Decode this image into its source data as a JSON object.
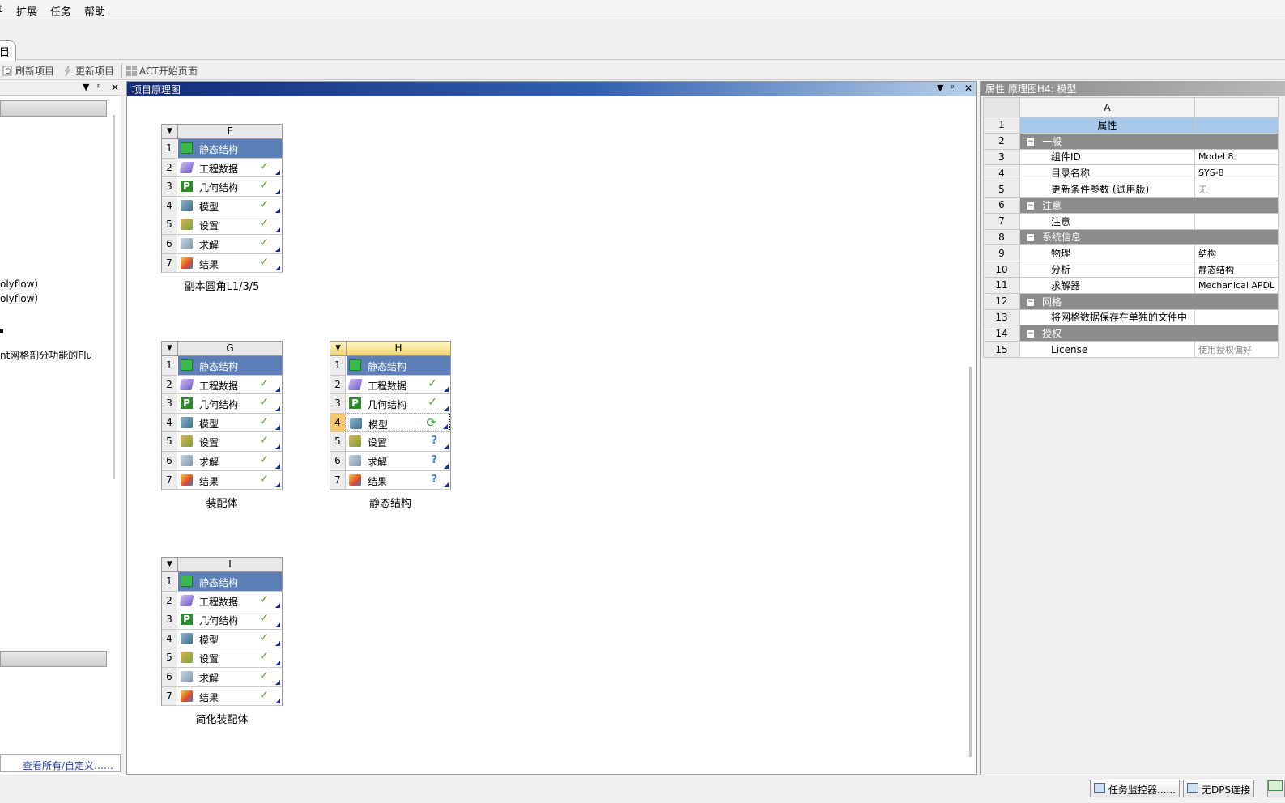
{
  "menu": {
    "items": [
      "扩展",
      "任务",
      "帮助"
    ],
    "cut_item": "t"
  },
  "ribbon": {
    "tab_label": "目"
  },
  "toolbar": {
    "refresh_label": "刷新项目",
    "update_label": "更新项目",
    "act_label": "ACT开始页面"
  },
  "left_panel": {
    "lines": [
      "olyflow）",
      "olyflow）",
      "nt网格剖分功能的Flu"
    ],
    "footer_link": "查看所有/自定义……"
  },
  "schematic": {
    "title": "项目原理图",
    "systems": [
      {
        "letter": "F",
        "caption": "副本圆角L1/3/5",
        "rows": [
          {
            "n": "1",
            "label": "静态结构",
            "icon": "static-structural-icon",
            "status": ""
          },
          {
            "n": "2",
            "label": "工程数据",
            "icon": "engineering-data-icon",
            "status": "✓"
          },
          {
            "n": "3",
            "label": "几何结构",
            "icon": "geometry-icon",
            "status": "✓"
          },
          {
            "n": "4",
            "label": "模型",
            "icon": "model-icon",
            "status": "✓"
          },
          {
            "n": "5",
            "label": "设置",
            "icon": "setup-icon",
            "status": "✓"
          },
          {
            "n": "6",
            "label": "求解",
            "icon": "solution-icon",
            "status": "✓"
          },
          {
            "n": "7",
            "label": "结果",
            "icon": "results-icon",
            "status": "✓"
          }
        ]
      },
      {
        "letter": "G",
        "caption": "装配体",
        "rows": [
          {
            "n": "1",
            "label": "静态结构",
            "icon": "static-structural-icon",
            "status": ""
          },
          {
            "n": "2",
            "label": "工程数据",
            "icon": "engineering-data-icon",
            "status": "✓"
          },
          {
            "n": "3",
            "label": "几何结构",
            "icon": "geometry-icon",
            "status": "✓"
          },
          {
            "n": "4",
            "label": "模型",
            "icon": "model-icon",
            "status": "✓"
          },
          {
            "n": "5",
            "label": "设置",
            "icon": "setup-icon",
            "status": "✓"
          },
          {
            "n": "6",
            "label": "求解",
            "icon": "solution-icon",
            "status": "✓"
          },
          {
            "n": "7",
            "label": "结果",
            "icon": "results-icon",
            "status": "✓"
          }
        ]
      },
      {
        "letter": "H",
        "caption": "静态结构",
        "rows": [
          {
            "n": "1",
            "label": "静态结构",
            "icon": "static-structural-icon",
            "status": ""
          },
          {
            "n": "2",
            "label": "工程数据",
            "icon": "engineering-data-icon",
            "status": "✓"
          },
          {
            "n": "3",
            "label": "几何结构",
            "icon": "geometry-icon",
            "status": "✓"
          },
          {
            "n": "4",
            "label": "模型",
            "icon": "model-icon",
            "status": "⟳"
          },
          {
            "n": "5",
            "label": "设置",
            "icon": "setup-icon",
            "status": "?"
          },
          {
            "n": "6",
            "label": "求解",
            "icon": "solution-icon",
            "status": "?"
          },
          {
            "n": "7",
            "label": "结果",
            "icon": "results-icon",
            "status": "?"
          }
        ]
      },
      {
        "letter": "I",
        "caption": "简化装配体",
        "rows": [
          {
            "n": "1",
            "label": "静态结构",
            "icon": "static-structural-icon",
            "status": ""
          },
          {
            "n": "2",
            "label": "工程数据",
            "icon": "engineering-data-icon",
            "status": "✓"
          },
          {
            "n": "3",
            "label": "几何结构",
            "icon": "geometry-icon",
            "status": "✓"
          },
          {
            "n": "4",
            "label": "模型",
            "icon": "model-icon",
            "status": "✓"
          },
          {
            "n": "5",
            "label": "设置",
            "icon": "setup-icon",
            "status": "✓"
          },
          {
            "n": "6",
            "label": "求解",
            "icon": "solution-icon",
            "status": "✓"
          },
          {
            "n": "7",
            "label": "结果",
            "icon": "results-icon",
            "status": "✓"
          }
        ]
      }
    ]
  },
  "properties": {
    "title": "属性 原理图H4: 模型",
    "col_a": "A",
    "rows": [
      {
        "n": "1",
        "type": "prophdr",
        "a": "属性",
        "b": ""
      },
      {
        "n": "2",
        "type": "grp",
        "a": "一般",
        "b": ""
      },
      {
        "n": "3",
        "type": "item",
        "a": "组件ID",
        "b": "Model 8"
      },
      {
        "n": "4",
        "type": "item",
        "a": "目录名称",
        "b": "SYS-8"
      },
      {
        "n": "5",
        "type": "item",
        "a": "更新条件参数 (试用版)",
        "b": "无"
      },
      {
        "n": "6",
        "type": "grp",
        "a": "注意",
        "b": ""
      },
      {
        "n": "7",
        "type": "item",
        "a": "注意",
        "b": ""
      },
      {
        "n": "8",
        "type": "grp",
        "a": "系统信息",
        "b": ""
      },
      {
        "n": "9",
        "type": "item",
        "a": "物理",
        "b": "结构"
      },
      {
        "n": "10",
        "type": "item",
        "a": "分析",
        "b": "静态结构"
      },
      {
        "n": "11",
        "type": "item",
        "a": "求解器",
        "b": "Mechanical APDL"
      },
      {
        "n": "12",
        "type": "grp",
        "a": "网格",
        "b": ""
      },
      {
        "n": "13",
        "type": "item",
        "a": "将网格数据保存在单独的文件中",
        "b": ""
      },
      {
        "n": "14",
        "type": "grp",
        "a": "授权",
        "b": ""
      },
      {
        "n": "15",
        "type": "item",
        "a": "License",
        "b": "使用授权偏好"
      }
    ]
  },
  "statusbar": {
    "task_monitor": "任务监控器......",
    "dps": "无DPS连接"
  },
  "colors": {
    "accent_blue": "#5b7fb6",
    "title_gradient_dark": "#142a7a",
    "check_green": "#5aa02c",
    "question_blue": "#3c7fc9",
    "active_header": "#f2d472"
  }
}
